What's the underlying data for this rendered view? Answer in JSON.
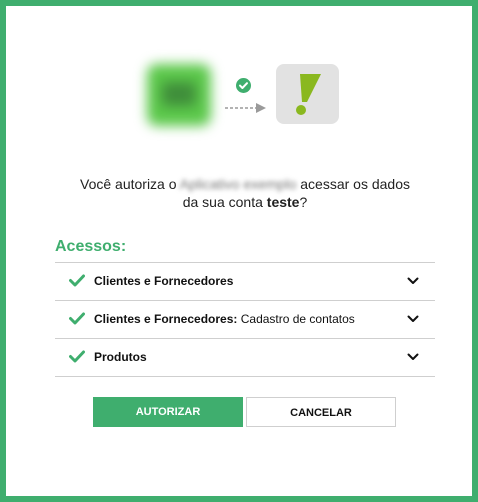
{
  "logos": {
    "app_logo_icon": "blurred-app-logo-icon",
    "target_logo_icon": "exclamation-logo-icon",
    "connection_icon": "check-circle-icon",
    "arrow_icon": "dashed-arrow-right-icon"
  },
  "question": {
    "prefix": "Você autoriza o ",
    "app_name": "Aplicativo exemplo",
    "middle": " acessar os dados",
    "line2_prefix": "da sua conta ",
    "account_name": "teste",
    "suffix": "?"
  },
  "access": {
    "title": "Acessos:",
    "items": [
      {
        "label": "Clientes e Fornecedores",
        "detail": ""
      },
      {
        "label": "Clientes e Fornecedores:",
        "detail": " Cadastro de contatos"
      },
      {
        "label": "Produtos",
        "detail": ""
      }
    ]
  },
  "buttons": {
    "authorize": "AUTORIZAR",
    "cancel": "CANCELAR"
  },
  "colors": {
    "accent": "#3fae6e",
    "exclamation": "#8ab81f",
    "target_bg": "#e2e2e2"
  }
}
